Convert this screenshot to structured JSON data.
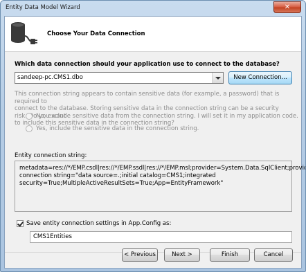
{
  "window": {
    "title": "Entity Data Model Wizard",
    "close_glyph": "✕"
  },
  "header": {
    "title": "Choose Your Data Connection",
    "icon": "database-plug-icon"
  },
  "connection": {
    "question": "Which data connection should your application use to connect to the database?",
    "selected": "sandeep-pc.CMS1.dbo",
    "new_connection_label": "New Connection...",
    "sensitive_line1": "This connection string appears to contain sensitive data (for example, a password) that is required to",
    "sensitive_line2": "connect to the database. Storing sensitive data in the connection string can be a security risk. Do you want",
    "sensitive_line3": "to include this sensitive data in the connection string?",
    "option_no": "No, exclude sensitive data from the connection string. I will set it in my application code.",
    "option_yes": "Yes, include the sensitive data in the connection string."
  },
  "entity_string": {
    "label": "Entity connection string:",
    "line1": "metadata=res://*/EMP.csdl|res://*/EMP.ssdl|res://*/EMP.msl;provider=System.Data.SqlClient;provider",
    "line2": "connection string=\"data source=.;initial catalog=CMS1;integrated",
    "line3": "security=True;MultipleActiveResultSets=True;App=EntityFramework\""
  },
  "save_settings": {
    "checked": true,
    "label": "Save entity connection settings in App.Config as:",
    "value": "CMS1Entities"
  },
  "footer": {
    "previous": "< Previous",
    "next": "Next >",
    "finish": "Finish",
    "cancel": "Cancel"
  }
}
